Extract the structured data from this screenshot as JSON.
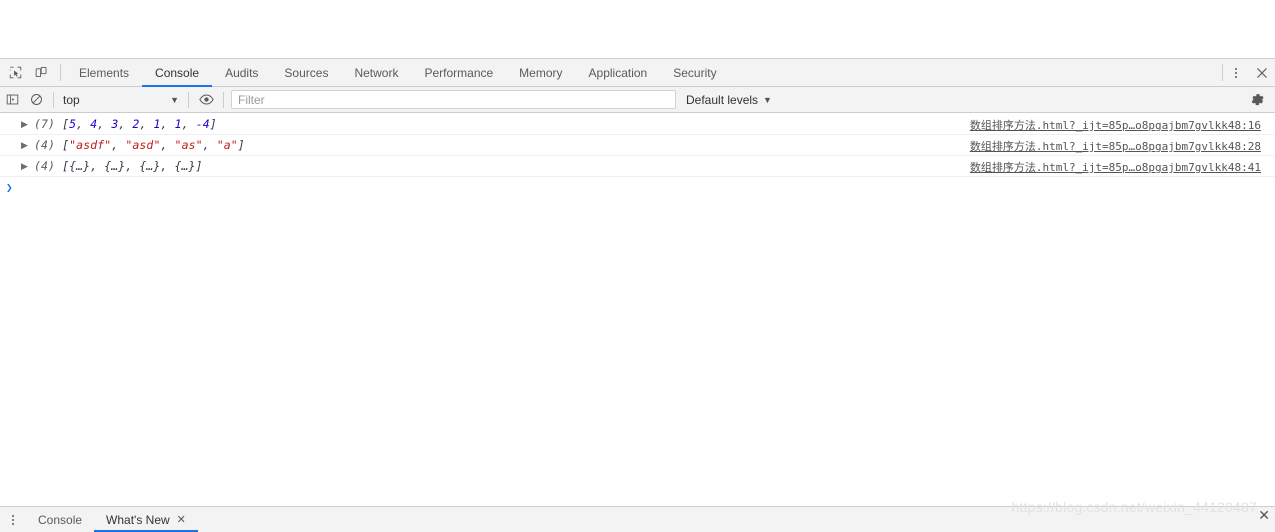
{
  "window": {
    "page_background": "#ffffff",
    "accent_color": "#1a73e8"
  },
  "main_tabbar": {
    "inspect_icon": "inspect-element-icon",
    "device_icon": "device-toolbar-icon",
    "more_icon": "more-options-icon",
    "close_icon": "close-icon",
    "tabs": [
      {
        "label": "Elements",
        "active": false
      },
      {
        "label": "Console",
        "active": true
      },
      {
        "label": "Audits",
        "active": false
      },
      {
        "label": "Sources",
        "active": false
      },
      {
        "label": "Network",
        "active": false
      },
      {
        "label": "Performance",
        "active": false
      },
      {
        "label": "Memory",
        "active": false
      },
      {
        "label": "Application",
        "active": false
      },
      {
        "label": "Security",
        "active": false
      }
    ]
  },
  "console_toolbar": {
    "sidebar_icon": "console-sidebar-icon",
    "clear_icon": "clear-console-icon",
    "context": "top",
    "context_caret": "▼",
    "eye_icon": "live-expression-eye-icon",
    "filter_placeholder": "Filter",
    "filter_value": "",
    "levels_label": "Default levels",
    "levels_caret": "▼",
    "settings_icon": "settings-gear-icon"
  },
  "console_messages": [
    {
      "disclosure": "▶",
      "count": "(7)",
      "preview_parts": [
        {
          "text": "[",
          "type": "bracket"
        },
        {
          "text": "5",
          "type": "num"
        },
        {
          "text": ", ",
          "type": "bracket"
        },
        {
          "text": "4",
          "type": "num"
        },
        {
          "text": ", ",
          "type": "bracket"
        },
        {
          "text": "3",
          "type": "num"
        },
        {
          "text": ", ",
          "type": "bracket"
        },
        {
          "text": "2",
          "type": "num"
        },
        {
          "text": ", ",
          "type": "bracket"
        },
        {
          "text": "1",
          "type": "num"
        },
        {
          "text": ", ",
          "type": "bracket"
        },
        {
          "text": "1",
          "type": "num"
        },
        {
          "text": ", ",
          "type": "bracket"
        },
        {
          "text": "-4",
          "type": "num"
        },
        {
          "text": "]",
          "type": "bracket"
        }
      ],
      "plain": "(7) [5, 4, 3, 2, 1, 1, -4]",
      "source": "数组排序方法.html?_ijt=85p…o8pgajbm7gvlkk48:16"
    },
    {
      "disclosure": "▶",
      "count": "(4)",
      "preview_parts": [
        {
          "text": "[",
          "type": "bracket"
        },
        {
          "text": "\"asdf\"",
          "type": "str"
        },
        {
          "text": ", ",
          "type": "bracket"
        },
        {
          "text": "\"asd\"",
          "type": "str"
        },
        {
          "text": ", ",
          "type": "bracket"
        },
        {
          "text": "\"as\"",
          "type": "str"
        },
        {
          "text": ", ",
          "type": "bracket"
        },
        {
          "text": "\"a\"",
          "type": "str"
        },
        {
          "text": "]",
          "type": "bracket"
        }
      ],
      "plain": "(4) [\"asdf\", \"asd\", \"as\", \"a\"]",
      "source": "数组排序方法.html?_ijt=85p…o8pgajbm7gvlkk48:28"
    },
    {
      "disclosure": "▶",
      "count": "(4)",
      "preview_parts": [
        {
          "text": "[{…}, {…}, {…}, {…}]",
          "type": "obj"
        }
      ],
      "plain": "(4) [{…}, {…}, {…}, {…}]",
      "source": "数组排序方法.html?_ijt=85p…o8pgajbm7gvlkk48:41"
    }
  ],
  "prompt": {
    "caret": "❯",
    "value": ""
  },
  "drawer": {
    "menu_icon": "drawer-more-options-icon",
    "tabs": [
      {
        "label": "Console",
        "active": false,
        "closable": false
      },
      {
        "label": "What's New",
        "active": true,
        "closable": true
      }
    ],
    "close_glyph": "✕"
  },
  "watermark": {
    "text": "https://blog.csdn.net/weixin_44120487",
    "close_glyph": "✕"
  }
}
